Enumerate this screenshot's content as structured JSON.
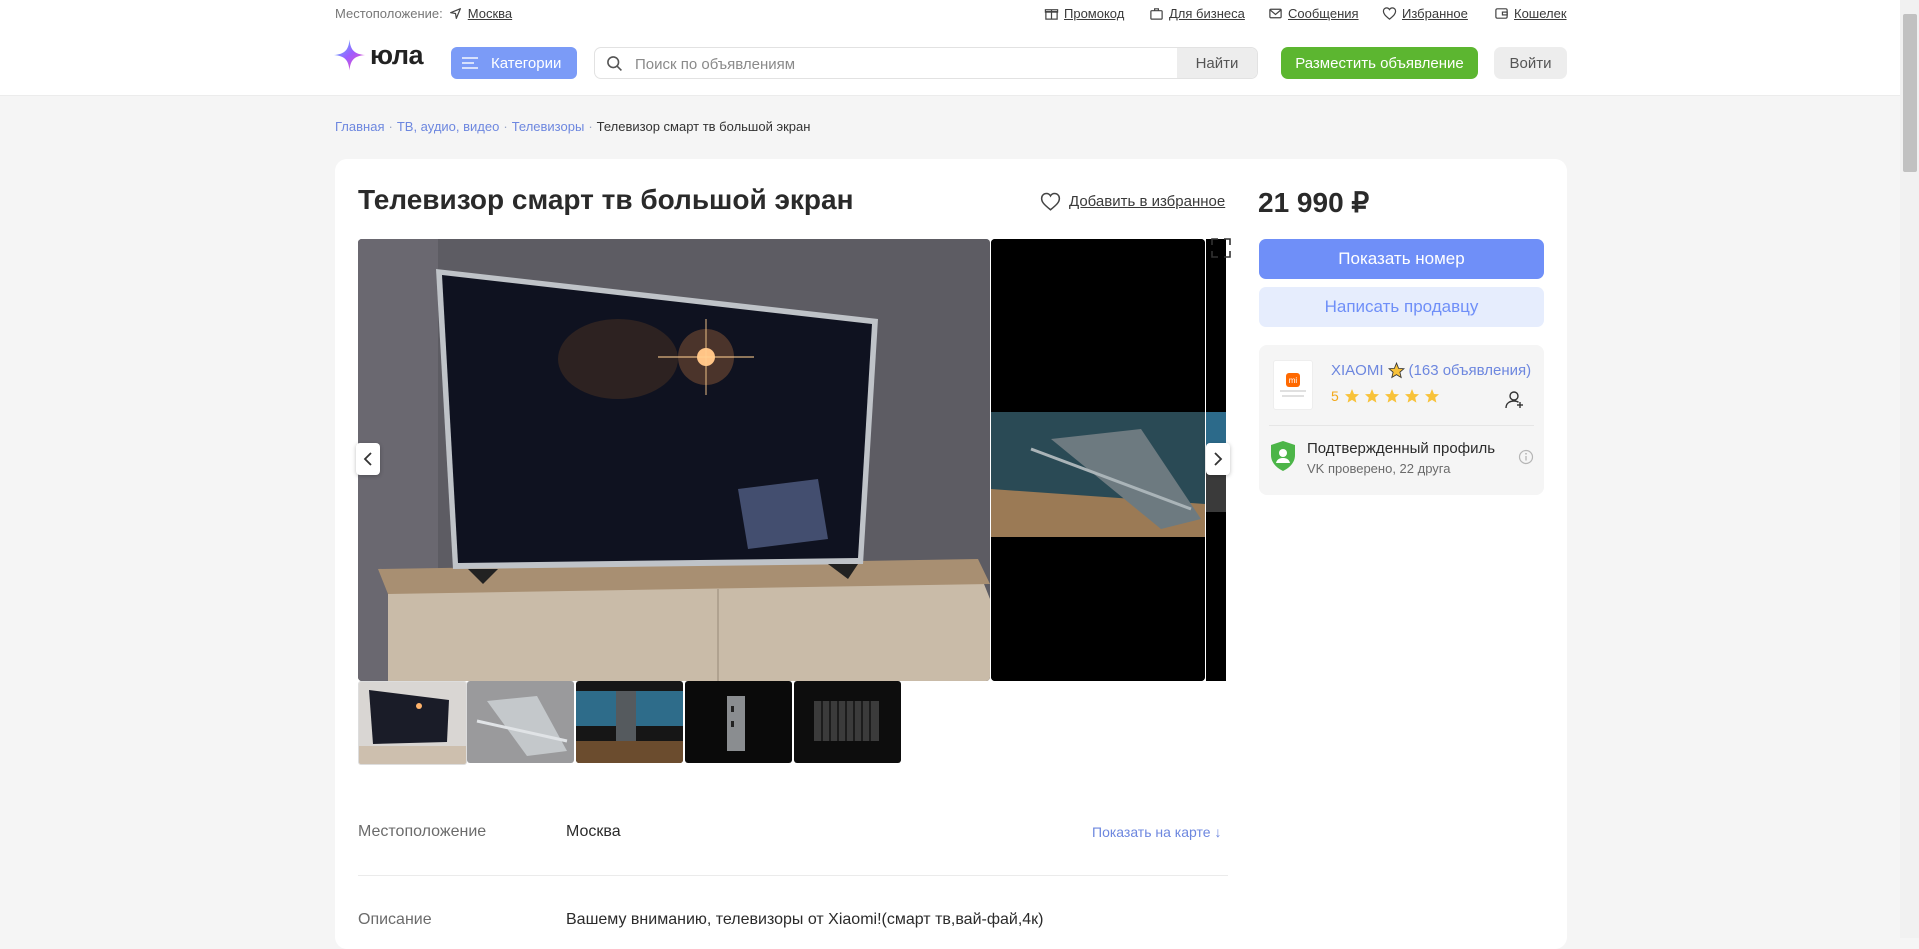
{
  "topbar": {
    "location_label": "Местоположение:",
    "location_city": "Москва",
    "links": [
      "Промокод",
      "Для бизнеса",
      "Сообщения",
      "Избранное",
      "Кошелек"
    ]
  },
  "header": {
    "logo_text": "юла",
    "categories_label": "Категории",
    "search_placeholder": "Поиск по объявлениям",
    "search_button": "Найти",
    "post_button": "Разместить объявление",
    "login_button": "Войти"
  },
  "breadcrumbs": [
    "Главная",
    "ТВ, аудио, видео",
    "Телевизоры",
    "Телевизор смарт тв большой экран"
  ],
  "listing": {
    "title": "Телевизор смарт тв большой экран",
    "favorite_label": "Добавить в избранное",
    "price": "21 990 ₽",
    "show_phone": "Показать номер",
    "write_seller": "Написать продавцу",
    "thumbnail_count": 5
  },
  "seller": {
    "name": "XIAOMI",
    "listings": "(163 объявления)",
    "rating": "5",
    "rating_stars": 5,
    "logo_text": "mi",
    "verified_title": "Подтвержденный профиль",
    "verified_sub": "VK проверено, 22 друга"
  },
  "details": {
    "location_label": "Местоположение",
    "location_value": "Москва",
    "map_link": "Показать на карте ↓",
    "description_label": "Описание",
    "description_value": "Вашему вниманию, телевизоры от Xiaomi!(смарт тв,вай-фай,4к)"
  },
  "colors": {
    "accent_blue": "#6f8ff8",
    "green": "#5cb630",
    "star": "#f8c23a"
  }
}
